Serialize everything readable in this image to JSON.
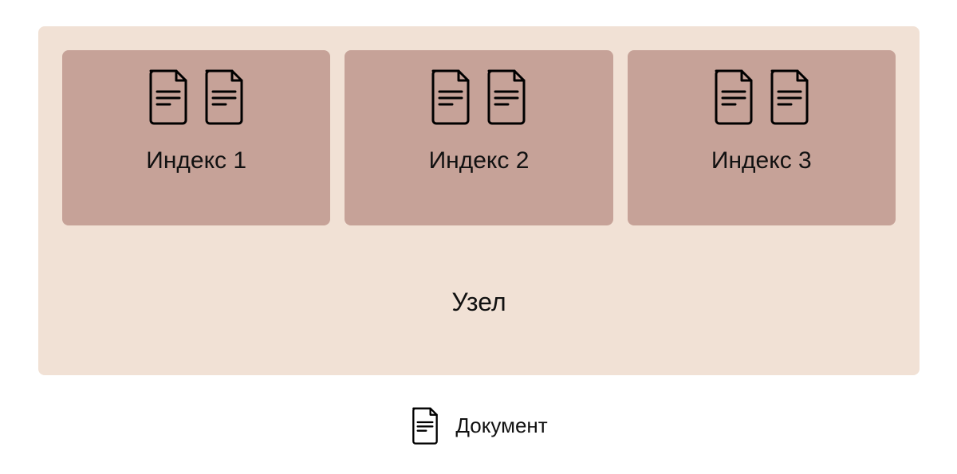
{
  "node": {
    "label": "Узел",
    "indexes": [
      {
        "label": "Индекс 1"
      },
      {
        "label": "Индекс 2"
      },
      {
        "label": "Индекс 3"
      }
    ]
  },
  "legend": {
    "document_label": "Документ"
  }
}
